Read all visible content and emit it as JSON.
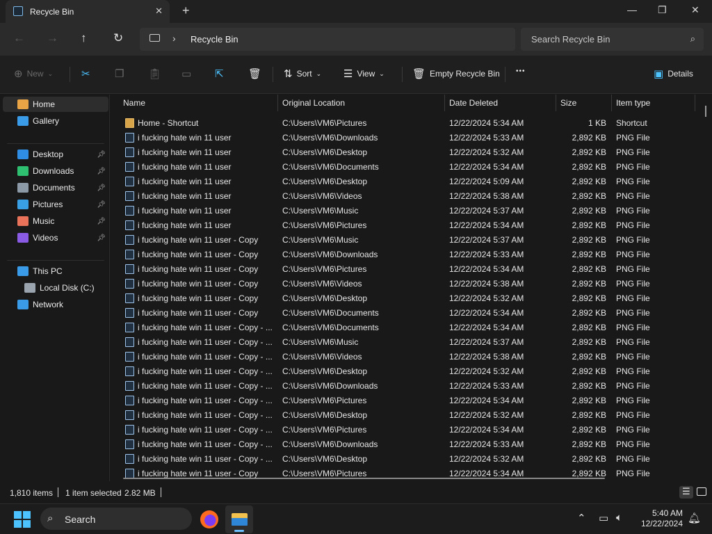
{
  "window": {
    "tab_title": "Recycle Bin",
    "tab_icon": "recycle-bin-icon",
    "close_tab": "✕",
    "new_tab": "+",
    "minimize": "—",
    "maximize": "❐",
    "close": "✕"
  },
  "nav": {
    "back": "←",
    "forward": "→",
    "up": "↑",
    "refresh": "↻",
    "breadcrumb_sep": "›",
    "path": "Recycle Bin",
    "search_placeholder": "Search Recycle Bin"
  },
  "toolbar": {
    "new_label": "New",
    "sort_label": "Sort",
    "view_label": "View",
    "empty_label": "Empty Recycle Bin",
    "more_label": "•••",
    "details_label": "Details"
  },
  "sidebar": {
    "items": [
      {
        "label": "Home",
        "icon": "home-icon",
        "color": "#e8a445",
        "pinned": false,
        "selected": true
      },
      {
        "label": "Gallery",
        "icon": "gallery-icon",
        "color": "#3a9be8",
        "pinned": false
      },
      {
        "label": "Desktop",
        "icon": "desktop-icon",
        "color": "#2f8de4",
        "pinned": true
      },
      {
        "label": "Downloads",
        "icon": "downloads-icon",
        "color": "#2fbf71",
        "pinned": true
      },
      {
        "label": "Documents",
        "icon": "documents-icon",
        "color": "#8c9aa8",
        "pinned": true
      },
      {
        "label": "Pictures",
        "icon": "pictures-icon",
        "color": "#3aa0e6",
        "pinned": true
      },
      {
        "label": "Music",
        "icon": "music-icon",
        "color": "#e8725a",
        "pinned": true
      },
      {
        "label": "Videos",
        "icon": "videos-icon",
        "color": "#8a5ce6",
        "pinned": true
      },
      {
        "label": "This PC",
        "icon": "this-pc-icon",
        "color": "#3a9be8",
        "pinned": false
      },
      {
        "label": "Local Disk (C:)",
        "icon": "local-disk-icon",
        "color": "#9aa4ae",
        "pinned": false
      },
      {
        "label": "Network",
        "icon": "network-icon",
        "color": "#3a9be8",
        "pinned": false
      }
    ]
  },
  "columns": {
    "name": "Name",
    "location": "Original Location",
    "date": "Date Deleted",
    "size": "Size",
    "type": "Item type"
  },
  "rows": [
    {
      "name": "Home - Shortcut",
      "location": "C:\\Users\\VM6\\Pictures",
      "date": "12/22/2024 5:34 AM",
      "size": "1 KB",
      "type": "Shortcut"
    },
    {
      "name": "i fucking hate win 11 user",
      "location": "C:\\Users\\VM6\\Downloads",
      "date": "12/22/2024 5:33 AM",
      "size": "2,892 KB",
      "type": "PNG File"
    },
    {
      "name": "i fucking hate win 11 user",
      "location": "C:\\Users\\VM6\\Desktop",
      "date": "12/22/2024 5:32 AM",
      "size": "2,892 KB",
      "type": "PNG File"
    },
    {
      "name": "i fucking hate win 11 user",
      "location": "C:\\Users\\VM6\\Documents",
      "date": "12/22/2024 5:34 AM",
      "size": "2,892 KB",
      "type": "PNG File"
    },
    {
      "name": "i fucking hate win 11 user",
      "location": "C:\\Users\\VM6\\Desktop",
      "date": "12/22/2024 5:09 AM",
      "size": "2,892 KB",
      "type": "PNG File"
    },
    {
      "name": "i fucking hate win 11 user",
      "location": "C:\\Users\\VM6\\Videos",
      "date": "12/22/2024 5:38 AM",
      "size": "2,892 KB",
      "type": "PNG File"
    },
    {
      "name": "i fucking hate win 11 user",
      "location": "C:\\Users\\VM6\\Music",
      "date": "12/22/2024 5:37 AM",
      "size": "2,892 KB",
      "type": "PNG File"
    },
    {
      "name": "i fucking hate win 11 user",
      "location": "C:\\Users\\VM6\\Pictures",
      "date": "12/22/2024 5:34 AM",
      "size": "2,892 KB",
      "type": "PNG File"
    },
    {
      "name": "i fucking hate win 11 user - Copy",
      "location": "C:\\Users\\VM6\\Music",
      "date": "12/22/2024 5:37 AM",
      "size": "2,892 KB",
      "type": "PNG File"
    },
    {
      "name": "i fucking hate win 11 user - Copy",
      "location": "C:\\Users\\VM6\\Downloads",
      "date": "12/22/2024 5:33 AM",
      "size": "2,892 KB",
      "type": "PNG File"
    },
    {
      "name": "i fucking hate win 11 user - Copy",
      "location": "C:\\Users\\VM6\\Pictures",
      "date": "12/22/2024 5:34 AM",
      "size": "2,892 KB",
      "type": "PNG File"
    },
    {
      "name": "i fucking hate win 11 user - Copy",
      "location": "C:\\Users\\VM6\\Videos",
      "date": "12/22/2024 5:38 AM",
      "size": "2,892 KB",
      "type": "PNG File"
    },
    {
      "name": "i fucking hate win 11 user - Copy",
      "location": "C:\\Users\\VM6\\Desktop",
      "date": "12/22/2024 5:32 AM",
      "size": "2,892 KB",
      "type": "PNG File"
    },
    {
      "name": "i fucking hate win 11 user - Copy",
      "location": "C:\\Users\\VM6\\Documents",
      "date": "12/22/2024 5:34 AM",
      "size": "2,892 KB",
      "type": "PNG File"
    },
    {
      "name": "i fucking hate win 11 user - Copy - ...",
      "location": "C:\\Users\\VM6\\Documents",
      "date": "12/22/2024 5:34 AM",
      "size": "2,892 KB",
      "type": "PNG File"
    },
    {
      "name": "i fucking hate win 11 user - Copy - ...",
      "location": "C:\\Users\\VM6\\Music",
      "date": "12/22/2024 5:37 AM",
      "size": "2,892 KB",
      "type": "PNG File"
    },
    {
      "name": "i fucking hate win 11 user - Copy - ...",
      "location": "C:\\Users\\VM6\\Videos",
      "date": "12/22/2024 5:38 AM",
      "size": "2,892 KB",
      "type": "PNG File"
    },
    {
      "name": "i fucking hate win 11 user - Copy - ...",
      "location": "C:\\Users\\VM6\\Desktop",
      "date": "12/22/2024 5:32 AM",
      "size": "2,892 KB",
      "type": "PNG File"
    },
    {
      "name": "i fucking hate win 11 user - Copy - ...",
      "location": "C:\\Users\\VM6\\Downloads",
      "date": "12/22/2024 5:33 AM",
      "size": "2,892 KB",
      "type": "PNG File"
    },
    {
      "name": "i fucking hate win 11 user - Copy - ...",
      "location": "C:\\Users\\VM6\\Pictures",
      "date": "12/22/2024 5:34 AM",
      "size": "2,892 KB",
      "type": "PNG File"
    },
    {
      "name": "i fucking hate win 11 user - Copy - ...",
      "location": "C:\\Users\\VM6\\Desktop",
      "date": "12/22/2024 5:32 AM",
      "size": "2,892 KB",
      "type": "PNG File"
    },
    {
      "name": "i fucking hate win 11 user - Copy - ...",
      "location": "C:\\Users\\VM6\\Pictures",
      "date": "12/22/2024 5:34 AM",
      "size": "2,892 KB",
      "type": "PNG File"
    },
    {
      "name": "i fucking hate win 11 user - Copy - ...",
      "location": "C:\\Users\\VM6\\Downloads",
      "date": "12/22/2024 5:33 AM",
      "size": "2,892 KB",
      "type": "PNG File"
    },
    {
      "name": "i fucking hate win 11 user - Copy - ...",
      "location": "C:\\Users\\VM6\\Desktop",
      "date": "12/22/2024 5:32 AM",
      "size": "2,892 KB",
      "type": "PNG File"
    },
    {
      "name": "i fucking hate win 11 user - Copy",
      "location": "C:\\Users\\VM6\\Pictures",
      "date": "12/22/2024 5:34 AM",
      "size": "2,892 KB",
      "type": "PNG File"
    }
  ],
  "status": {
    "count": "1,810 items",
    "selected": "1 item selected",
    "size": "2.82 MB"
  },
  "taskbar": {
    "search_label": "Search",
    "time": "5:40 AM",
    "date": "12/22/2024",
    "accent": "#4cc2ff"
  }
}
